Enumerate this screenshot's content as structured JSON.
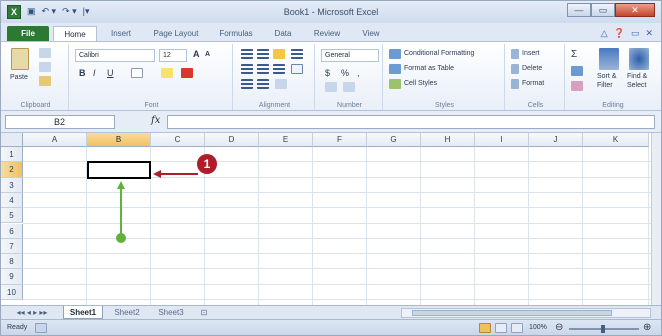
{
  "window": {
    "title": "Book1 - Microsoft Excel",
    "quick_access": [
      "▣",
      "↶ ▾",
      "↷ ▾",
      "|▾"
    ],
    "buttons": [
      "—",
      "▭",
      "✕"
    ]
  },
  "tabs": [
    "File",
    "Home",
    "Insert",
    "Page Layout",
    "Formulas",
    "Data",
    "Review",
    "View"
  ],
  "ribbon": {
    "clipboard": {
      "paste": "Paste",
      "label": "Clipboard"
    },
    "font": {
      "name": "Calibri",
      "size": "12",
      "bold": "B",
      "italic": "I",
      "underline": "U",
      "grow": "A",
      "shrink": "A",
      "label": "Font"
    },
    "alignment": {
      "label": "Alignment"
    },
    "number": {
      "format": "General",
      "currency": "$",
      "percent": "%",
      "comma": ",",
      "label": "Number"
    },
    "styles": {
      "conditional": "Conditional Formatting",
      "format_table": "Format as Table",
      "cell_styles": "Cell Styles",
      "label": "Styles"
    },
    "cells": {
      "insert": "Insert",
      "delete": "Delete",
      "format": "Format",
      "label": "Cells"
    },
    "editing": {
      "sigma": "Σ",
      "sort": "Sort &",
      "sort2": "Filter",
      "find": "Find &",
      "find2": "Select",
      "label": "Editing"
    }
  },
  "formula_bar": {
    "name_box": "B2",
    "fx": "fx",
    "content": ""
  },
  "columns": [
    "A",
    "B",
    "C",
    "D",
    "E",
    "F",
    "G",
    "H",
    "I",
    "J",
    "K"
  ],
  "rows": [
    "1",
    "2",
    "3",
    "4",
    "5",
    "6",
    "7",
    "8",
    "9",
    "10"
  ],
  "selection": {
    "column": "B",
    "row": "2"
  },
  "sheets": [
    "Sheet1",
    "Sheet2",
    "Sheet3"
  ],
  "status": {
    "ready": "Ready",
    "zoom": "100%"
  },
  "annotation": {
    "number": "1"
  },
  "colors": {
    "file_tab": "#2b7a34",
    "callout": "#b01d2a",
    "green_arrow": "#5fb33a",
    "selection_header": "#f1c15f"
  }
}
